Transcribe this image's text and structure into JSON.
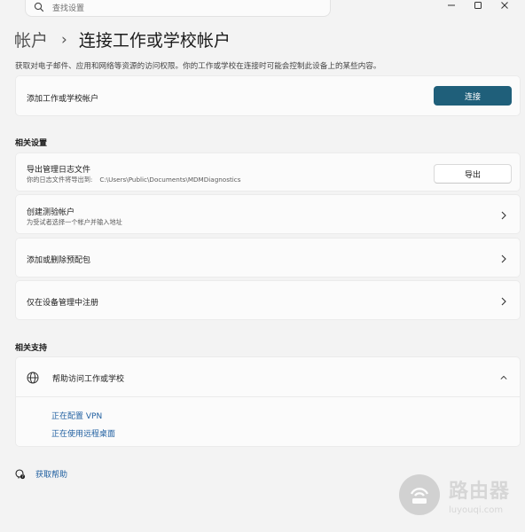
{
  "search": {
    "placeholder": "查找设置"
  },
  "header": {
    "breadcrumb_parent": "帐户",
    "separator": "›",
    "title": "连接工作或学校帐户"
  },
  "description": "获取对电子邮件、应用和网络等资源的访问权限。你的工作或学校在连接时可能会控制此设备上的某些内容。",
  "add_account": {
    "label": "添加工作或学校帐户",
    "button": "连接"
  },
  "related_settings": {
    "title": "相关设置",
    "export_logs": {
      "label": "导出管理日志文件",
      "sub_prefix": "你的日志文件将导出到:",
      "path": "C:\\Users\\Public\\Documents\\MDMDiagnostics",
      "button": "导出"
    },
    "test_account": {
      "label": "创建测验帐户",
      "sub": "为受试者选择一个帐户并输入地址"
    },
    "provisioning": {
      "label": "添加或删除预配包"
    },
    "enroll_mgmt": {
      "label": "仅在设备管理中注册"
    }
  },
  "related_support": {
    "title": "相关支持",
    "help_header": "帮助访问工作或学校",
    "links": [
      "正在配置 VPN",
      "正在使用远程桌面"
    ]
  },
  "get_help": "获取帮助",
  "watermark": {
    "cn": "路由器",
    "en": "luyouqi.com"
  },
  "colors": {
    "accent": "#1f5f7a",
    "link": "#1f5fa0",
    "background": "#f3f3f3",
    "card": "#fbfbfb"
  }
}
